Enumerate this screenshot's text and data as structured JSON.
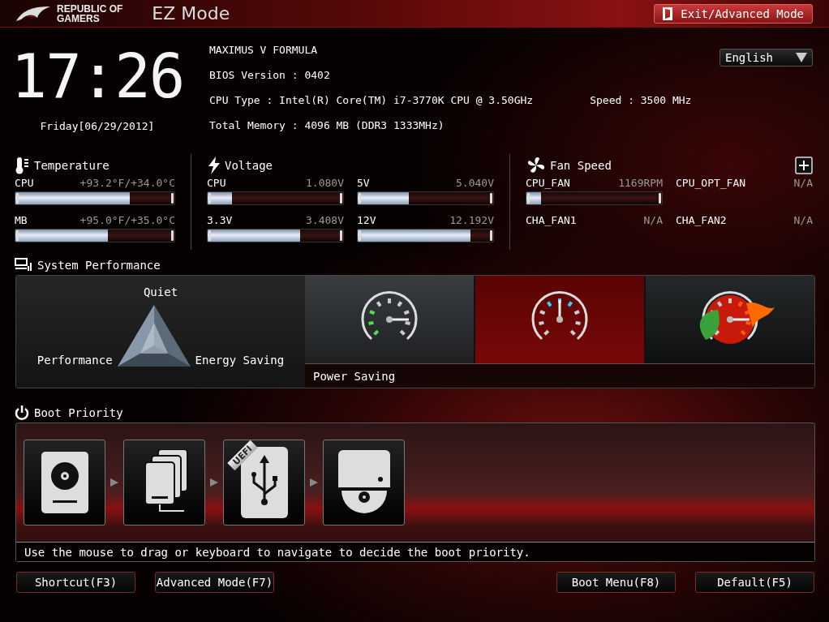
{
  "header": {
    "brand_lines": [
      "REPUBLIC OF",
      "GAMERS"
    ],
    "mode_title": "EZ Mode",
    "exit_button": "Exit/Advanced Mode"
  },
  "clock": {
    "time": "17:26",
    "date": "Friday[06/29/2012]"
  },
  "system_info": {
    "model": "MAXIMUS V FORMULA",
    "bios_version": "BIOS Version : 0402",
    "cpu_type": "CPU Type : Intel(R) Core(TM) i7-3770K CPU @ 3.50GHz",
    "speed": "Speed : 3500 MHz",
    "total_memory": "Total Memory : 4096 MB (DDR3 1333MHz)"
  },
  "language": {
    "value": "English"
  },
  "monitors": [
    {
      "kind": "temperature",
      "title": "Temperature",
      "items": [
        {
          "name": "CPU",
          "reading": "+93.2°F/+34.0°C",
          "level": 0.72
        },
        {
          "name": "MB",
          "reading": "+95.0°F/+35.0°C",
          "level": 0.58
        }
      ]
    },
    {
      "kind": "voltage",
      "title": "Voltage",
      "items": [
        {
          "name": "CPU",
          "reading": "1.080V",
          "level": 0.18
        },
        {
          "name": "5V",
          "reading": "5.040V",
          "level": 0.38
        },
        {
          "name": "3.3V",
          "reading": "3.408V",
          "level": 0.68
        },
        {
          "name": "12V",
          "reading": "12.192V",
          "level": 0.83
        }
      ]
    },
    {
      "kind": "fan",
      "title": "Fan Speed",
      "items": [
        {
          "name": "CPU_FAN",
          "reading": "1169RPM",
          "level": 0.11
        },
        {
          "name": "CPU_OPT_FAN",
          "reading": "N/A"
        },
        {
          "name": "CHA_FAN1",
          "reading": "N/A"
        },
        {
          "name": "CHA_FAN2",
          "reading": "N/A"
        }
      ]
    }
  ],
  "performance": {
    "title": "System Performance",
    "triangle_labels": {
      "top": "Quiet",
      "left": "Performance",
      "right": "Energy Saving"
    },
    "modes": [
      {
        "kind": "power-saving",
        "selected": false
      },
      {
        "kind": "normal",
        "selected": true
      },
      {
        "kind": "optimal",
        "selected": false
      }
    ],
    "status": "Power Saving"
  },
  "boot": {
    "title": "Boot Priority",
    "devices": [
      {
        "kind": "hdd"
      },
      {
        "kind": "disk-stack"
      },
      {
        "kind": "usb",
        "badge": "UEFI"
      },
      {
        "kind": "optical"
      }
    ],
    "hint": "Use the mouse to drag or keyboard to navigate to decide the boot priority."
  },
  "buttons": {
    "left": [
      "Shortcut(F3)",
      "Advanced Mode(F7)"
    ],
    "right": [
      "Boot Menu(F8)",
      "Default(F5)"
    ]
  }
}
